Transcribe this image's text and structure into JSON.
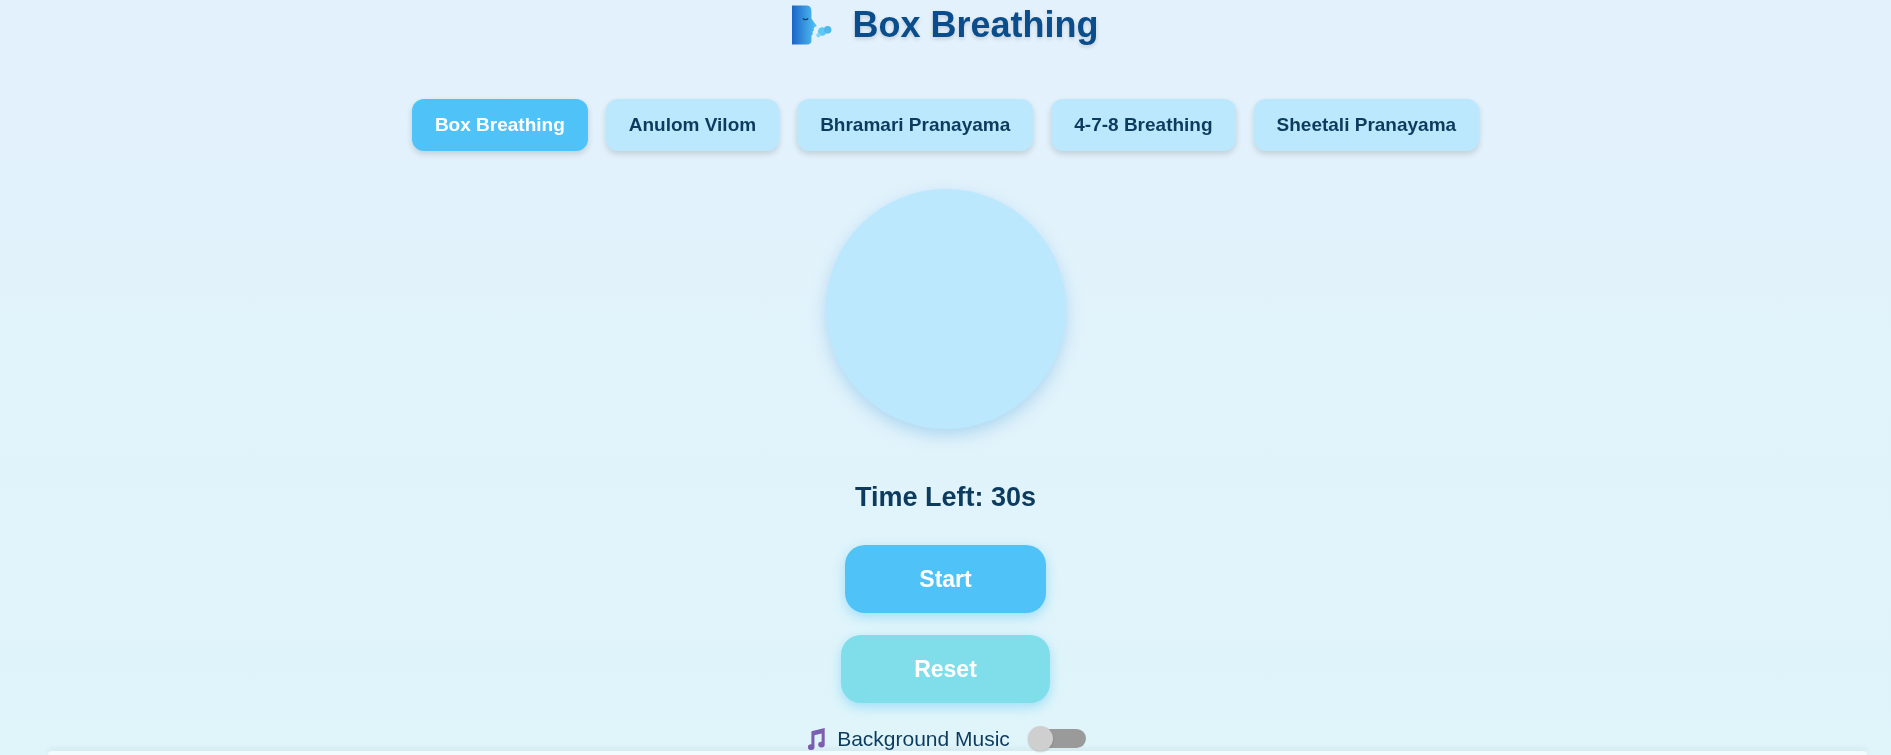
{
  "header": {
    "title": "Box Breathing"
  },
  "tabs": [
    {
      "label": "Box Breathing",
      "selected": true
    },
    {
      "label": "Anulom Vilom",
      "selected": false
    },
    {
      "label": "Bhramari Pranayama",
      "selected": false
    },
    {
      "label": "4-7-8 Breathing",
      "selected": false
    },
    {
      "label": "Sheetali Pranayama",
      "selected": false
    }
  ],
  "timer": {
    "text": "Time Left: 30s"
  },
  "buttons": [
    {
      "label": "Start",
      "kind": "primary"
    },
    {
      "label": "Reset",
      "kind": "secondary"
    }
  ],
  "music": {
    "label": "Background Music",
    "on": false
  }
}
